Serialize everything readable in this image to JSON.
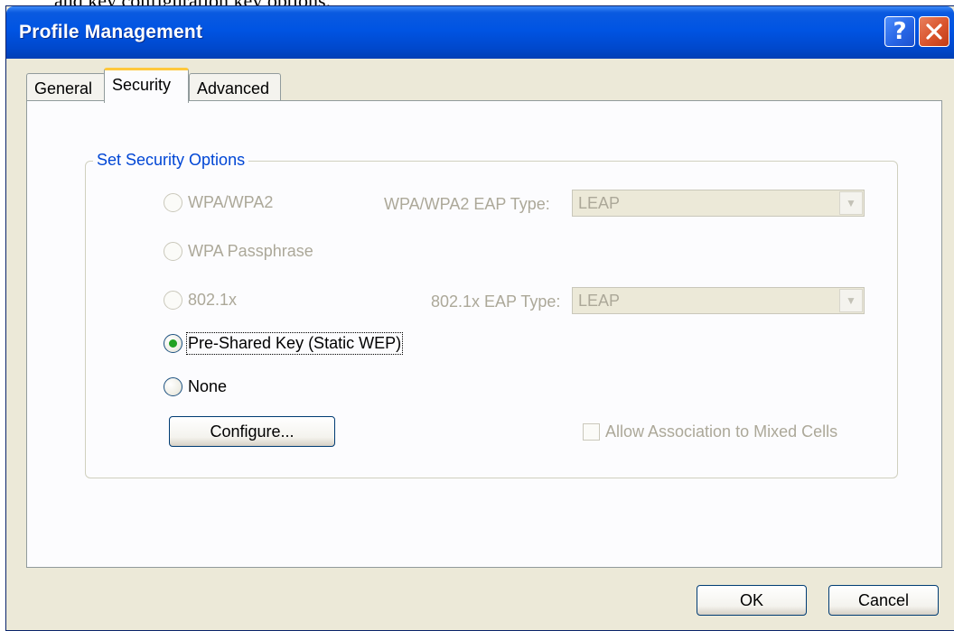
{
  "top_crop_text": "and key configuration key options.",
  "window": {
    "title": "Profile Management",
    "help_glyph": "?",
    "close_glyph": "✕"
  },
  "tabs": [
    {
      "label": "General",
      "selected": false
    },
    {
      "label": "Security",
      "selected": true
    },
    {
      "label": "Advanced",
      "selected": false
    }
  ],
  "security": {
    "group_title": "Set Security Options",
    "options": [
      {
        "label": "WPA/WPA2",
        "selected": false,
        "enabled": false
      },
      {
        "label": "WPA Passphrase",
        "selected": false,
        "enabled": false
      },
      {
        "label": "802.1x",
        "selected": false,
        "enabled": false
      },
      {
        "label": "Pre-Shared Key (Static WEP)",
        "selected": true,
        "enabled": true
      },
      {
        "label": "None",
        "selected": false,
        "enabled": true
      }
    ],
    "wpa_eap_type_label": "WPA/WPA2 EAP Type:",
    "wpa_eap_type_value": "LEAP",
    "dot1x_eap_type_label": "802.1x EAP Type:",
    "dot1x_eap_type_value": "LEAP",
    "configure_label": "Configure...",
    "mixed_cells_label": "Allow Association to Mixed Cells",
    "mixed_cells_checked": false
  },
  "footer": {
    "ok_label": "OK",
    "cancel_label": "Cancel"
  },
  "colors": {
    "titlebar": "#0054e3",
    "group_title": "#0046d5",
    "disabled_text": "#aca899",
    "dialog_bg": "#ece9d8"
  }
}
